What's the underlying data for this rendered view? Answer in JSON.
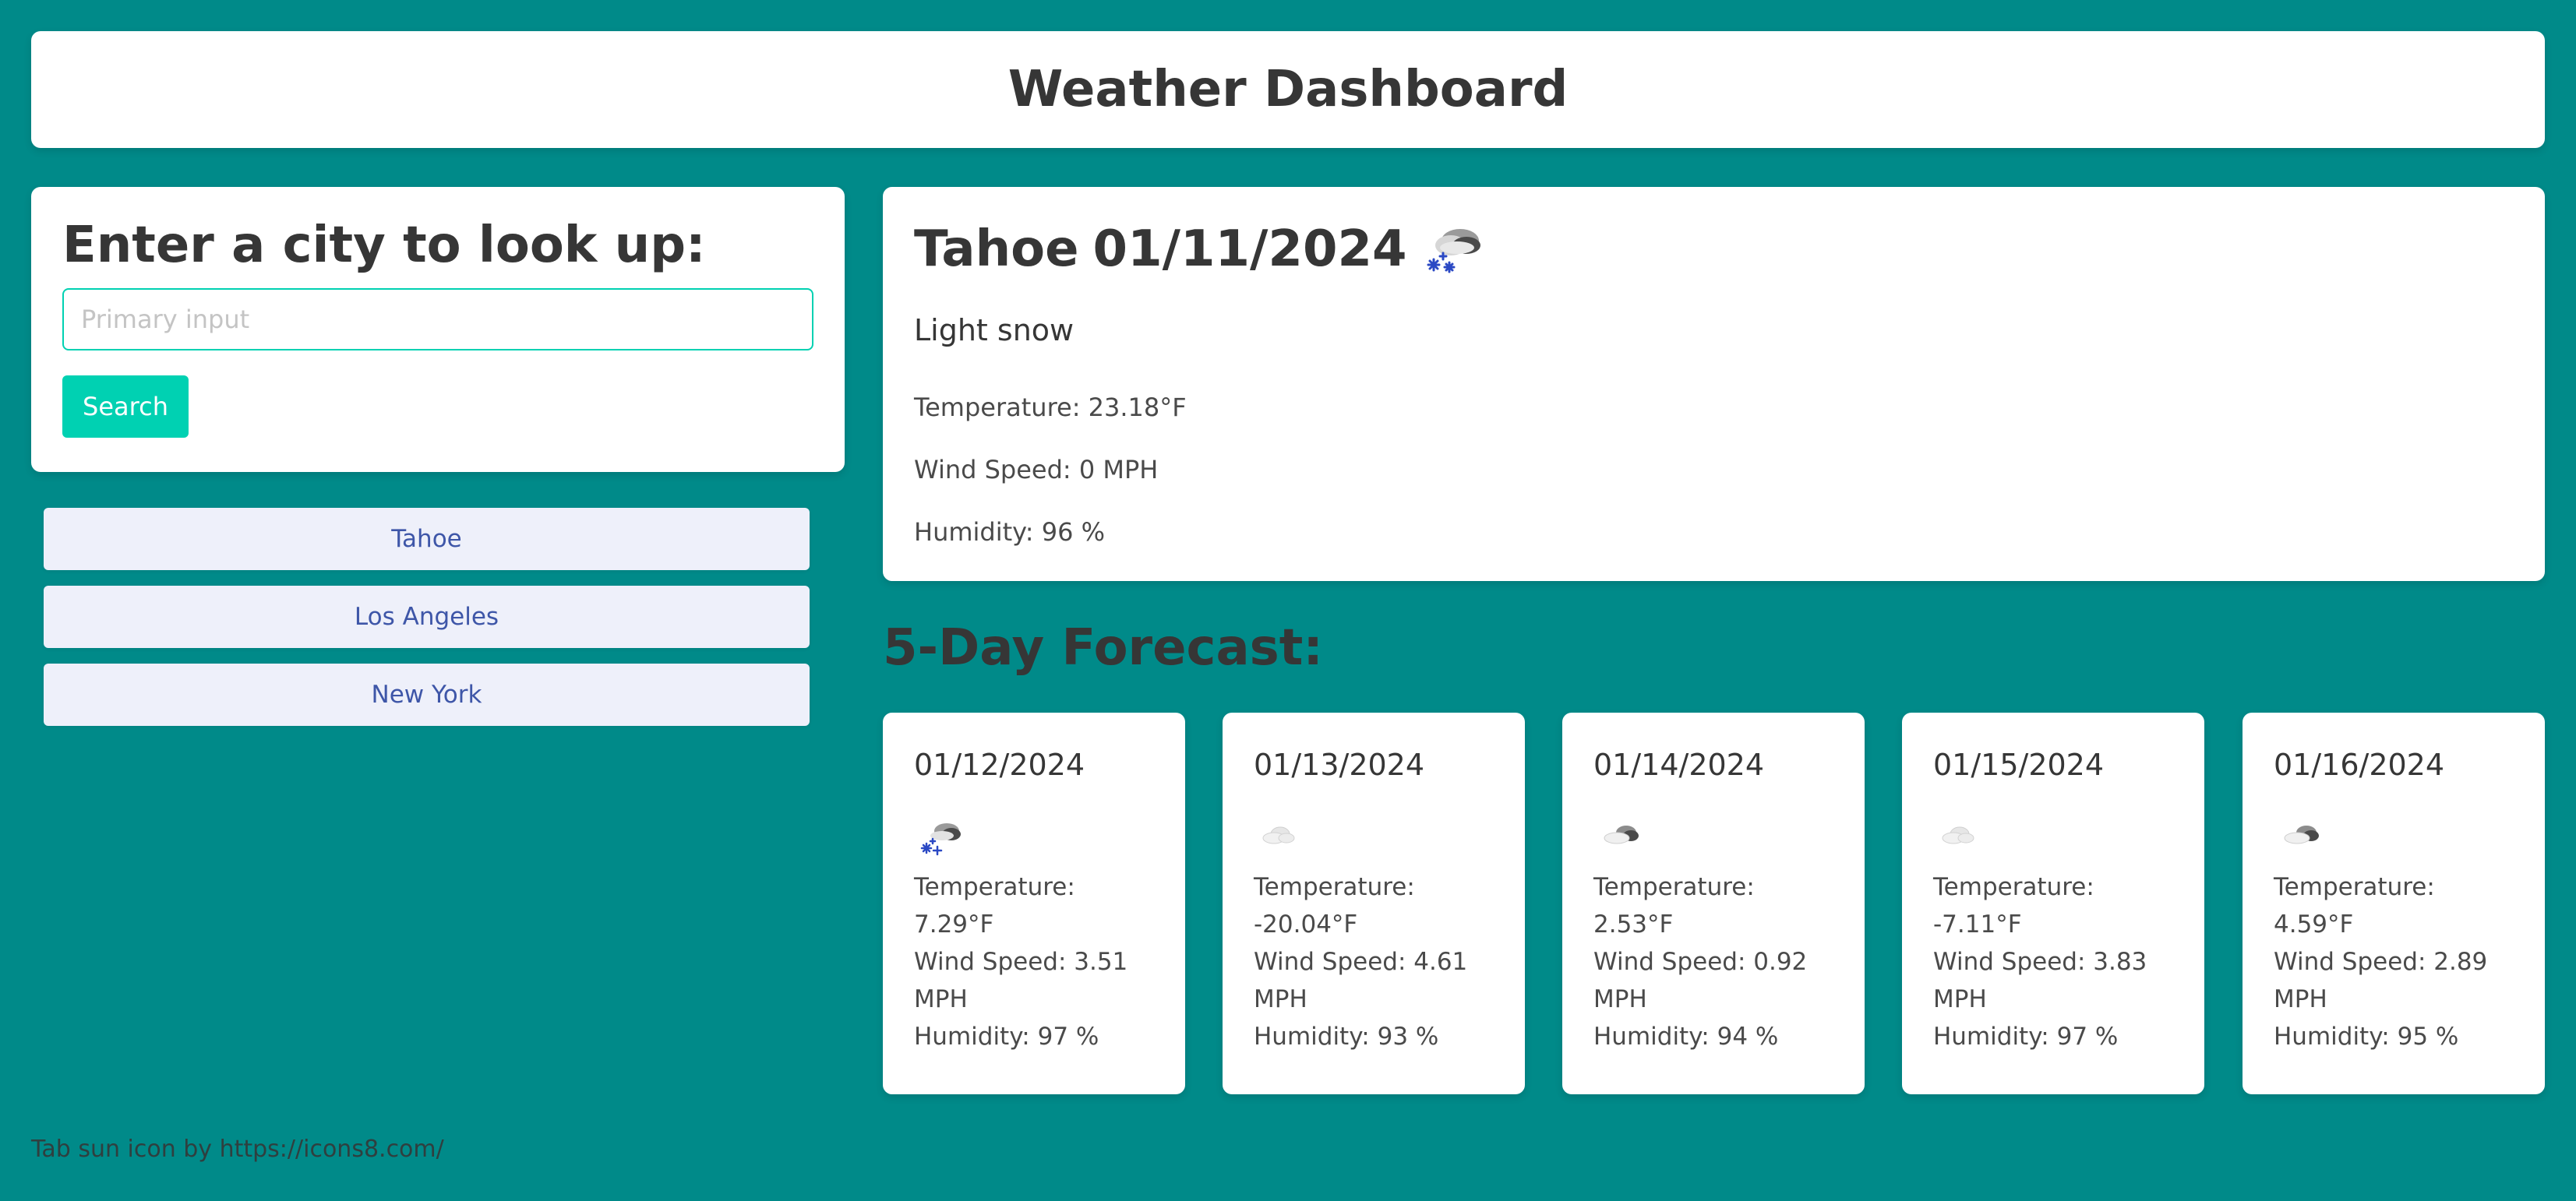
{
  "header": {
    "title": "Weather Dashboard"
  },
  "search": {
    "heading": "Enter a city to look up:",
    "placeholder": "Primary input",
    "button_label": "Search"
  },
  "history": [
    "Tahoe",
    "Los Angeles",
    "New York"
  ],
  "current": {
    "city": "Tahoe",
    "date": "01/11/2024",
    "icon": "snow-cloud-icon",
    "description": "Light snow",
    "temperature": "Temperature: 23.18°F",
    "wind": "Wind Speed: 0 MPH",
    "humidity": "Humidity: 96 %"
  },
  "forecast": {
    "title": "5-Day Forecast:",
    "days": [
      {
        "date": "01/12/2024",
        "icon": "snow-cloud-icon",
        "temp_label": "Temperature: 7.29°F",
        "wind_label": "Wind Speed: 3.51",
        "wind_unit": "MPH",
        "humidity": "Humidity: 97 %"
      },
      {
        "date": "01/13/2024",
        "icon": "cloud-icon",
        "temp_label": "Temperature:",
        "temp_value": "-20.04°F",
        "wind_label": "Wind Speed: 4.61",
        "wind_unit": "MPH",
        "humidity": "Humidity: 93 %"
      },
      {
        "date": "01/14/2024",
        "icon": "dark-cloud-icon",
        "temp_label": "Temperature: 2.53°F",
        "wind_label": "Wind Speed: 0.92",
        "wind_unit": "MPH",
        "humidity": "Humidity: 94 %"
      },
      {
        "date": "01/15/2024",
        "icon": "cloud-icon",
        "temp_label": "Temperature: -7.11°F",
        "wind_label": "Wind Speed: 3.83",
        "wind_unit": "MPH",
        "humidity": "Humidity: 97 %"
      },
      {
        "date": "01/16/2024",
        "icon": "dark-cloud-icon",
        "temp_label": "Temperature: 4.59°F",
        "wind_label": "Wind Speed: 2.89",
        "wind_unit": "MPH",
        "humidity": "Humidity: 95 %"
      }
    ]
  },
  "footer": {
    "credit": "Tab sun icon by https://icons8.com/"
  },
  "colors": {
    "background": "#008a89",
    "accent": "#00d1b2",
    "history_bg": "#eef0fa",
    "history_text": "#3e56a8"
  }
}
